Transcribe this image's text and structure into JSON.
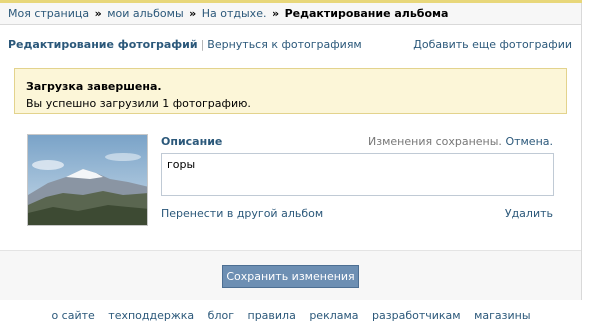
{
  "breadcrumb": {
    "items": [
      "Моя страница",
      "мои альбомы",
      "На отдыхе."
    ],
    "separator": "»",
    "current": "Редактирование альбома"
  },
  "tabs": {
    "active": "Редактирование фотографий",
    "divider": "|",
    "back": "Вернуться к фотографиям",
    "add_more": "Добавить еще фотографии"
  },
  "notice": {
    "title": "Загрузка завершена.",
    "text": "Вы успешно загрузили 1 фотографию."
  },
  "photo_editor": {
    "description_label": "Описание",
    "saved_status": "Изменения сохранены.",
    "cancel": "Отмена.",
    "description_value": "горы",
    "move_link": "Перенести в другой альбом",
    "delete_link": "Удалить"
  },
  "save_button": "Сохранить изменения",
  "footer": {
    "links": [
      "о сайте",
      "техподдержка",
      "блог",
      "правила",
      "реклама",
      "разработчикам",
      "магазины"
    ]
  },
  "colors": {
    "link": "#2b587a",
    "notice_bg": "#fcf6d8",
    "button_bg": "#6d8fb3"
  }
}
